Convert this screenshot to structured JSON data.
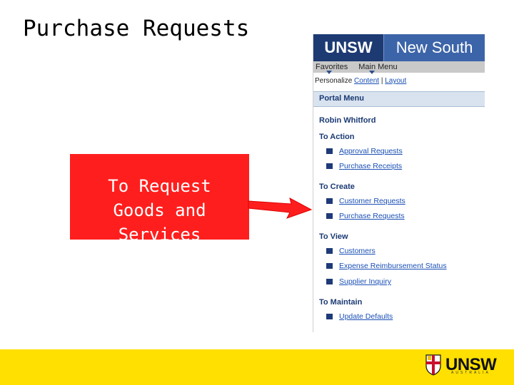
{
  "slide": {
    "title": "Purchase Requests",
    "callout": "To Request\nGoods and\nServices"
  },
  "screenshot": {
    "banner_logo": "UNSW",
    "banner_tagline": "New South",
    "menubar": [
      "Favorites",
      "Main Menu"
    ],
    "personalize": {
      "prefix": "Personalize",
      "content_link": "Content",
      "separator": "|",
      "layout_link": "Layout"
    },
    "portal_menu_title": "Portal Menu",
    "user_name": "Robin Whitford",
    "sections": [
      {
        "heading": "To Action",
        "items": [
          "Approval Requests",
          "Purchase Receipts"
        ]
      },
      {
        "heading": "To Create",
        "items": [
          "Customer Requests",
          "Purchase Requests"
        ]
      },
      {
        "heading": "To View",
        "items": [
          "Customers",
          "Expense Reimbursement Status",
          "Supplier Inquiry"
        ]
      },
      {
        "heading": "To Maintain",
        "items": [
          "Update Defaults"
        ]
      }
    ]
  },
  "footer": {
    "logo_text": "UNSW",
    "logo_subtext": "AUSTRALIA"
  },
  "colors": {
    "callout": "#ff1e1e",
    "footer": "#ffe000",
    "banner": "#1f3f7a",
    "link": "#1a4fb5"
  }
}
